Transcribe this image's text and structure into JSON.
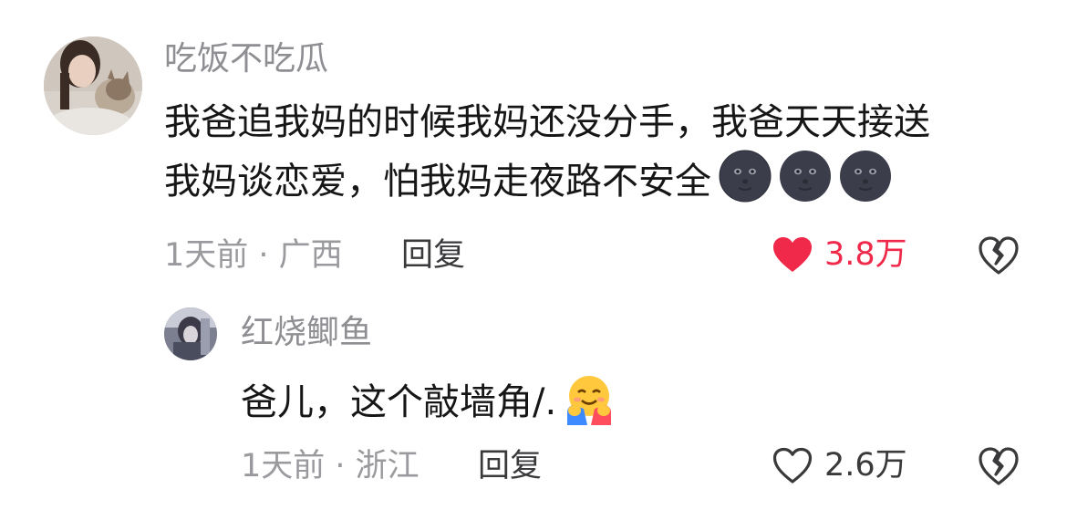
{
  "comment": {
    "username": "吃饭不吃瓜",
    "lines": [
      "我爸追我妈的时候我妈还没分手，我爸天天接送",
      "我妈谈恋爱，怕我妈走夜路不安全"
    ],
    "emojis": [
      "new-moon-face-emoji",
      "new-moon-face-emoji",
      "new-moon-face-emoji"
    ],
    "time": "1天前",
    "location": "广西",
    "reply_label": "回复",
    "likes": "3.8万",
    "liked": true,
    "like_color": "#f0284a"
  },
  "reply": {
    "username": "红烧鲫鱼",
    "text": "爸儿，这个敲墙角/.",
    "emoji": "smiling-face-with-open-hands-emoji",
    "time": "1天前",
    "location": "浙江",
    "reply_label": "回复",
    "likes": "2.6万",
    "liked": false
  },
  "separator": " · "
}
